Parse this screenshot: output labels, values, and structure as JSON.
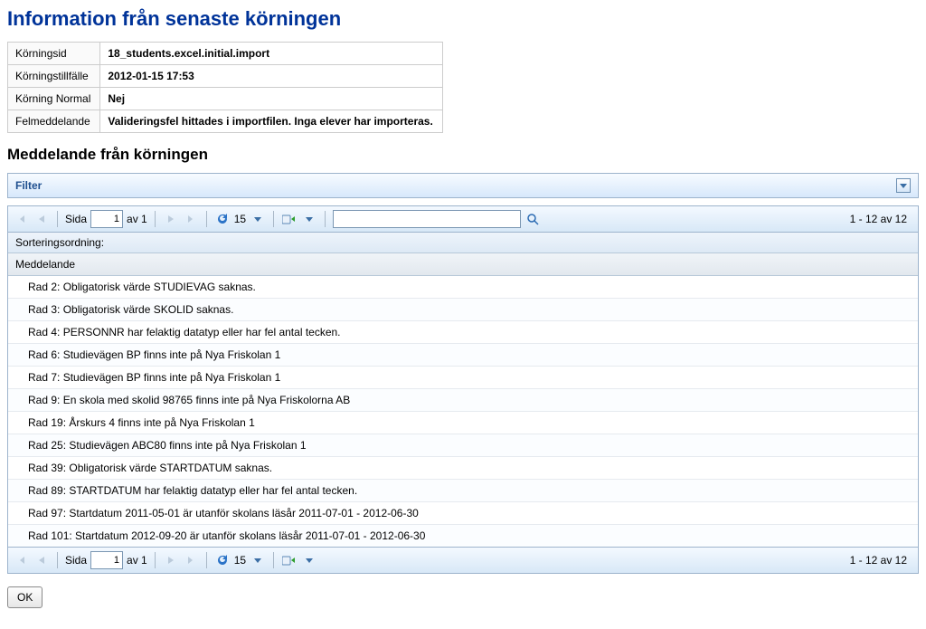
{
  "titles": {
    "page": "Information från senaste körningen",
    "section": "Meddelande från körningen"
  },
  "info": {
    "rows": [
      {
        "label": "Körningsid",
        "value": "18_students.excel.initial.import"
      },
      {
        "label": "Körningstillfälle",
        "value": "2012-01-15 17:53"
      },
      {
        "label": "Körning Normal",
        "value": "Nej"
      },
      {
        "label": "Felmeddelande",
        "value": "Valideringsfel hittades i importfilen. Inga elever har importeras."
      }
    ]
  },
  "filter": {
    "label": "Filter"
  },
  "toolbar": {
    "page_label_prefix": "Sida",
    "page_value": "1",
    "page_label_suffix": "av 1",
    "pagesize": "15",
    "status": "1 - 12 av 12"
  },
  "grid": {
    "sort_label": "Sorteringsordning:",
    "column_header": "Meddelande",
    "rows": [
      "Rad 2: Obligatorisk värde STUDIEVAG saknas.",
      "Rad 3: Obligatorisk värde SKOLID saknas.",
      "Rad 4: PERSONNR har felaktig datatyp eller har fel antal tecken.",
      "Rad 6: Studievägen BP finns inte på Nya Friskolan 1",
      "Rad 7: Studievägen BP finns inte på Nya Friskolan 1",
      "Rad 9: En skola med skolid 98765 finns inte på Nya Friskolorna AB",
      "Rad 19: Årskurs 4 finns inte på Nya Friskolan 1",
      "Rad 25: Studievägen ABC80 finns inte på Nya Friskolan 1",
      "Rad 39: Obligatorisk värde STARTDATUM saknas.",
      "Rad 89: STARTDATUM har felaktig datatyp eller har fel antal tecken.",
      "Rad 97: Startdatum 2011-05-01 är utanför skolans läsår 2011-07-01 - 2012-06-30",
      "Rad 101: Startdatum 2012-09-20 är utanför skolans läsår 2011-07-01 - 2012-06-30"
    ]
  },
  "buttons": {
    "ok": "OK"
  }
}
